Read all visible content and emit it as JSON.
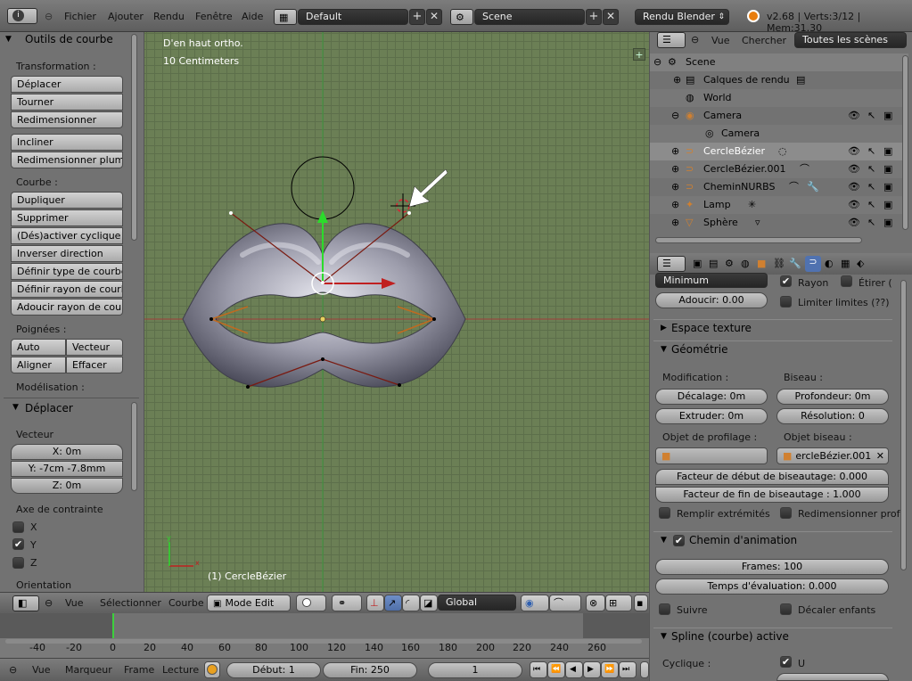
{
  "topbar": {
    "info_icon": "info-icon",
    "menus": [
      "Fichier",
      "Ajouter",
      "Rendu",
      "Fenêtre",
      "Aide"
    ],
    "layout": "Default",
    "scene": "Scene",
    "engine": "Rendu Blender",
    "stats": "v2.68 | Verts:3/12 | Mem:31.30"
  },
  "toolshelf": {
    "title": "Outils de courbe",
    "transform_label": "Transformation :",
    "transform_buttons": [
      "Déplacer",
      "Tourner",
      "Redimensionner"
    ],
    "tilt_buttons": [
      "Incliner",
      "Redimensionner plume de"
    ],
    "curve_label": "Courbe :",
    "curve_buttons": [
      "Dupliquer",
      "Supprimer",
      "(Dés)activer cyclique",
      "Inverser direction",
      "Définir type de courbe",
      "Définir rayon de courbe",
      "Adoucir rayon de courbe"
    ],
    "handles_label": "Poignées :",
    "handles": [
      "Auto",
      "Vecteur",
      "Aligner",
      "Effacer"
    ],
    "modeling_label": "Modélisation :",
    "op_title": "Déplacer",
    "vector_label": "Vecteur",
    "x": "X: 0m",
    "y": "Y: -7cm -7.8mm",
    "z": "Z: 0m",
    "constraint_label": "Axe de contrainte",
    "axes": [
      {
        "name": "X",
        "checked": false
      },
      {
        "name": "Y",
        "checked": true
      },
      {
        "name": "Z",
        "checked": false
      }
    ],
    "orientation_label": "Orientation"
  },
  "viewport": {
    "view_name": "D'en haut ortho.",
    "scale": "10 Centimeters",
    "object": "(1) CercleBézier",
    "colors": {
      "bg": "#6b7f55",
      "curve": "#7a1a10",
      "x_axis": "#a03c3c",
      "y_axis": "#2bdc2b"
    }
  },
  "vpheader": {
    "view": "Vue",
    "select": "Sélectionner",
    "curve": "Courbe",
    "mode": "Mode Edit",
    "orientation": "Global"
  },
  "timeline": {
    "ticks": [
      "-40",
      "-20",
      "0",
      "20",
      "40",
      "60",
      "80",
      "100",
      "120",
      "140",
      "160",
      "180",
      "200",
      "220",
      "240",
      "260"
    ],
    "current_frame_marker": 0
  },
  "tlfooter": {
    "view": "Vue",
    "marker": "Marqueur",
    "frame": "Frame",
    "playback": "Lecture",
    "start": "Début: 1",
    "end": "Fin: 250",
    "current": "1"
  },
  "outliner": {
    "view": "Vue",
    "search": "Chercher",
    "filter": "Toutes les scènes",
    "items": [
      {
        "name": "Scene",
        "indent": 0
      },
      {
        "name": "Calques de rendu",
        "indent": 1
      },
      {
        "name": "World",
        "indent": 1
      },
      {
        "name": "Camera",
        "indent": 1
      },
      {
        "name": "Camera",
        "indent": 2
      },
      {
        "name": "CercleBézier",
        "indent": 1
      },
      {
        "name": "CercleBézier.001",
        "indent": 1
      },
      {
        "name": "CheminNURBS",
        "indent": 1
      },
      {
        "name": "Lamp",
        "indent": 1
      },
      {
        "name": "Sphère",
        "indent": 1
      }
    ]
  },
  "props": {
    "twist": "Minimum",
    "radius_label": "Rayon",
    "stretch_label": "Étirer (",
    "smooth": "Adoucir: 0.00",
    "limit_label": "Limiter limites (??)",
    "texture_space": "Espace texture",
    "geometry": "Géométrie",
    "modification": "Modification :",
    "bevel": "Biseau :",
    "offset": "Décalage: 0m",
    "depth": "Profondeur: 0m",
    "extrude": "Extruder: 0m",
    "resolution": "Résolution: 0",
    "taper_label": "Objet de profilage :",
    "bevel_obj_label": "Objet biseau :",
    "bevel_obj": "ercleBézier.001",
    "bevel_start": "Facteur de début de biseautage: 0.000",
    "bevel_end": "Facteur de fin de biseautage : 1.000",
    "fill_caps": "Remplir extrémités",
    "scale_profile": "Redimensionner prof",
    "path_anim": "Chemin d'animation",
    "frames": "Frames: 100",
    "eval_time": "Temps d'évaluation: 0.000",
    "follow": "Suivre",
    "offset_children": "Décaler enfants",
    "active_spline": "Spline (courbe) active",
    "cyclic": "Cyclique :",
    "u": "U"
  }
}
